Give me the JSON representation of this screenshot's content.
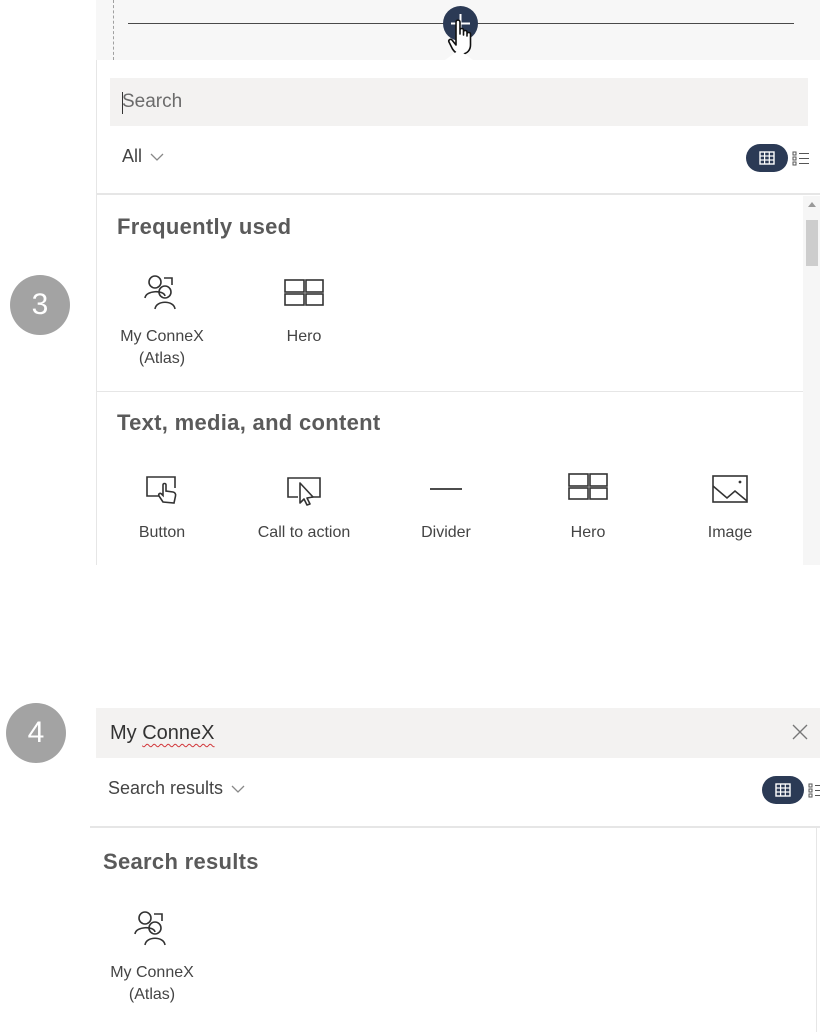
{
  "steps": {
    "step3": "3",
    "step4": "4"
  },
  "panel3": {
    "search": {
      "placeholder": "Search"
    },
    "filter": {
      "selected": "All"
    },
    "sections": [
      {
        "title": "Frequently used",
        "items": [
          {
            "label_line1": "My ConneX",
            "label_line2": "(Atlas)",
            "icon": "people-icon"
          },
          {
            "label_line1": "Hero",
            "icon": "hero-layout-icon"
          }
        ]
      },
      {
        "title": "Text, media, and content",
        "items": [
          {
            "label": "Button",
            "icon": "button-touch-icon"
          },
          {
            "label": "Call to action",
            "icon": "call-to-action-icon"
          },
          {
            "label": "Divider",
            "icon": "divider-icon"
          },
          {
            "label": "Hero",
            "icon": "hero-layout-icon"
          },
          {
            "label": "Image",
            "icon": "image-icon"
          }
        ]
      }
    ]
  },
  "panel4": {
    "search": {
      "value": "My ConneX",
      "value_prefix": "My ",
      "value_misspelled": "ConneX"
    },
    "filter": {
      "selected": "Search results"
    },
    "section": {
      "title": "Search results",
      "items": [
        {
          "label_line1": "My ConneX",
          "label_line2": "(Atlas)",
          "icon": "people-icon"
        }
      ]
    }
  },
  "colors": {
    "accent": "#2b3a55",
    "badge": "#a3a3a3",
    "search_bg": "#f3f2f1",
    "spell_error": "#d13438"
  }
}
